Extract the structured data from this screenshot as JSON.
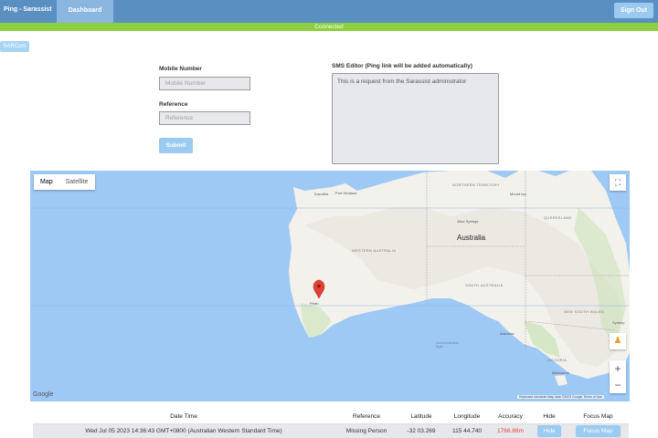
{
  "header": {
    "brand": "Ping - Sarassist",
    "tab_dashboard": "Dashboard",
    "signout_label": "Sign Out"
  },
  "status": {
    "text": "Connected"
  },
  "sidebar": {
    "sarcom_label": "SARCom"
  },
  "form": {
    "mobile_label": "Mobile Number",
    "mobile_placeholder": "Mobile Number",
    "reference_label": "Reference",
    "reference_placeholder": "Reference",
    "submit_label": "Submit",
    "sms_label": "SMS Editor (Ping link will be added automatically)",
    "sms_value": "This is a request from the Sarassist administrator"
  },
  "map": {
    "type_map": "Map",
    "type_satellite": "Satellite",
    "labels": {
      "australia": "Australia",
      "western_australia": "WESTERN AUSTRALIA",
      "northern_territory": "NORTHERN TERRITORY",
      "queensland": "QUEENSLAND",
      "south_australia": "SOUTH AUSTRALIA",
      "new_south_wales": "NEW SOUTH WALES",
      "victoria": "VICTORIA",
      "port_hedland": "Port Hedland",
      "karratha": "Karratha",
      "alice_springs": "Alice Springs",
      "mount_isa": "Mount Isa",
      "adelaide": "Adelaide",
      "melbourne": "Melbourne",
      "sydney": "Sydney",
      "perth": "Perth",
      "bight": "Great Australian Bight"
    },
    "google": "Google",
    "attribution": "Keyboard shortcuts   Map data ©2023 Google   Terms of Use"
  },
  "table": {
    "headers": [
      "Date Time",
      "Reference",
      "Latitude",
      "Longitude",
      "Accuracy",
      "Hide",
      "Focus Map"
    ],
    "rows": [
      {
        "datetime": "Wed Jul 05 2023 14:36:43 GMT+0800 (Australian Western Standard Time)",
        "reference": "Missing Person",
        "latitude": "-32 03.269",
        "longitude": "115 44.740",
        "accuracy": "1766.88m",
        "hide_label": "Hide",
        "focus_label": "Focus Map"
      }
    ]
  },
  "colors": {
    "header": "#5a8fc2",
    "connected": "#8ccf3e",
    "button": "#9ccbf1",
    "accuracy": "#e0463e"
  }
}
